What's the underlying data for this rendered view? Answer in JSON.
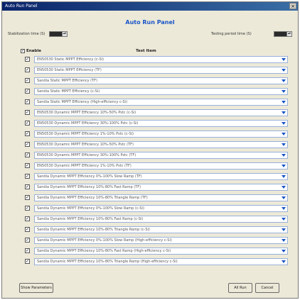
{
  "window": {
    "title": "Auto Run Panel"
  },
  "panel": {
    "title": "Auto Run Panel",
    "stabilization_label": "Stabilization time (S)",
    "testing_label": "Testing period time (S)"
  },
  "list": {
    "enable_header": "Enable",
    "item_header": "Test Item",
    "items": [
      "EN50530 Static MPPT Efficiency (c-Si)",
      "EN50530 Static MPPT Efficiency (TF)",
      "Sandia Static MPPT Efficiency (TF)",
      "Sandia Static MPPT Efficiency (c-Si)",
      "Sandia Static MPPT Efficiency (High-efficiency c-Si)",
      "EN50530 Dynamic MPPT Efficiency 10%-50% Pstc (c-Si)",
      "EN50530 Dynamic MPPT Efficiency 30%-100% Pstc (c-Si)",
      "EN50530 Dynamic MPPT Efficiency 1%-10% Pstc (c-Si)",
      "EN50530 Dynamic MPPT Efficiency 10%-50% Pstc (TF)",
      "EN50530 Dynamic MPPT Efficiency 30%-100% Pstc (TF)",
      "EN50530 Dynamic MPPT Efficiency 1%-10% Pstc (TF)",
      "Sandia Dynamic MPPT Efficiency 0%-100% Slow Ramp (TF)",
      "Sandia Dynamic MPPT Efficiency 10%-80% Fast Ramp (TF)",
      "Sandia Dynamic MPPT Efficiency 10%-80% Triangle Ramp (TF)",
      "Sandia Dynamic MPPT Efficiency 0%-100% Slow Ramp (c-Si)",
      "Sandia Dynamic MPPT Efficiency 10%-80% Fast Ramp (c-Si)",
      "Sandia Dynamic MPPT Efficiency 10%-80% Triangle Ramp (c-Si)",
      "Sandia Dynamic MPPT Efficiency 0%-100% Slow Ramp (High-efficiency c-Si)",
      "Sandia Dynamic MPPT Efficiency 10%-80% Fast Ramp (High-efficiency c-Si)",
      "Sandia Dynamic MPPT Efficiency 10%-80% Triangle Ramp (High-efficiency c-Si)"
    ]
  },
  "buttons": {
    "show_parameters": "Show Parameters",
    "run": "All Run",
    "cancel": "Cancel"
  },
  "colors": {
    "accent": "#1a55c8",
    "titlebar": "#0a246a"
  }
}
